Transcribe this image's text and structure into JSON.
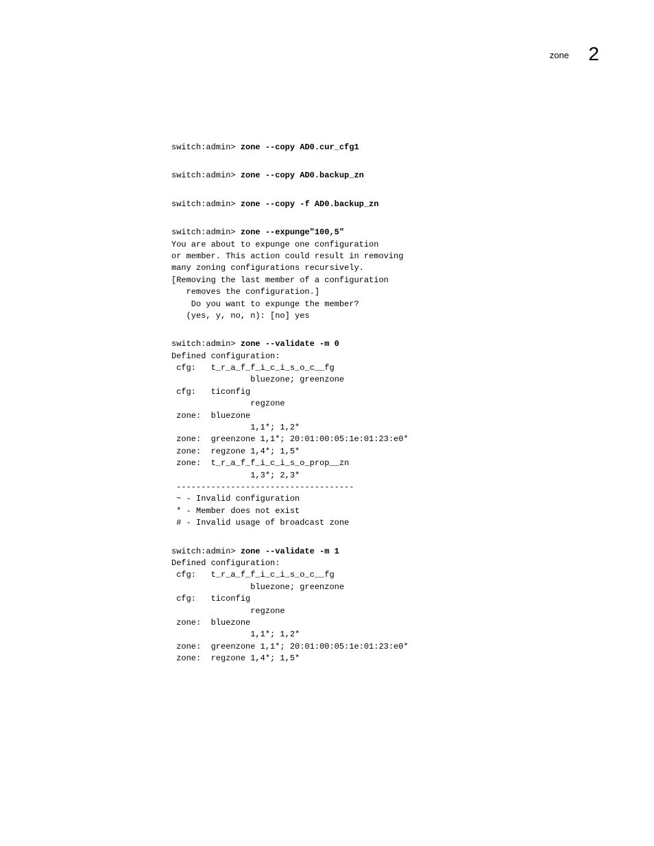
{
  "header": {
    "label": "zone",
    "pageNumber": "2"
  },
  "blocks": {
    "b1": {
      "prompt": "switch:admin> ",
      "cmd": "zone --copy AD0.cur_cfg1"
    },
    "b2": {
      "prompt": "switch:admin> ",
      "cmd": "zone --copy AD0.backup_zn"
    },
    "b3": {
      "prompt": "switch:admin> ",
      "cmd": "zone --copy -f AD0.backup_zn"
    },
    "b4": {
      "prompt": "switch:admin> ",
      "cmd": "zone --expunge\"100,5\"",
      "body": "You are about to expunge one configuration\nor member. This action could result in removing\nmany zoning configurations recursively.\n[Removing the last member of a configuration\n   removes the configuration.]\n    Do you want to expunge the member?\n   (yes, y, no, n): [no] yes"
    },
    "b5": {
      "prompt": "switch:admin> ",
      "cmd": "zone --validate -m 0",
      "body": "Defined configuration:\n cfg:   t_r_a_f_f_i_c_i_s_o_c__fg\n                bluezone; greenzone\n cfg:   ticonfig\n                regzone\n zone:  bluezone\n                1,1*; 1,2*\n zone:  greenzone 1,1*; 20:01:00:05:1e:01:23:e0*\n zone:  regzone 1,4*; 1,5*\n zone:  t_r_a_f_f_i_c_i_s_o_prop__zn\n                1,3*; 2,3*\n ------------------------------------\n ~ - Invalid configuration\n * - Member does not exist\n # - Invalid usage of broadcast zone"
    },
    "b6": {
      "prompt": "switch:admin> ",
      "cmd": "zone --validate -m 1",
      "body": "Defined configuration:\n cfg:   t_r_a_f_f_i_c_i_s_o_c__fg\n                bluezone; greenzone\n cfg:   ticonfig\n                regzone\n zone:  bluezone\n                1,1*; 1,2*\n zone:  greenzone 1,1*; 20:01:00:05:1e:01:23:e0*\n zone:  regzone 1,4*; 1,5*"
    }
  }
}
